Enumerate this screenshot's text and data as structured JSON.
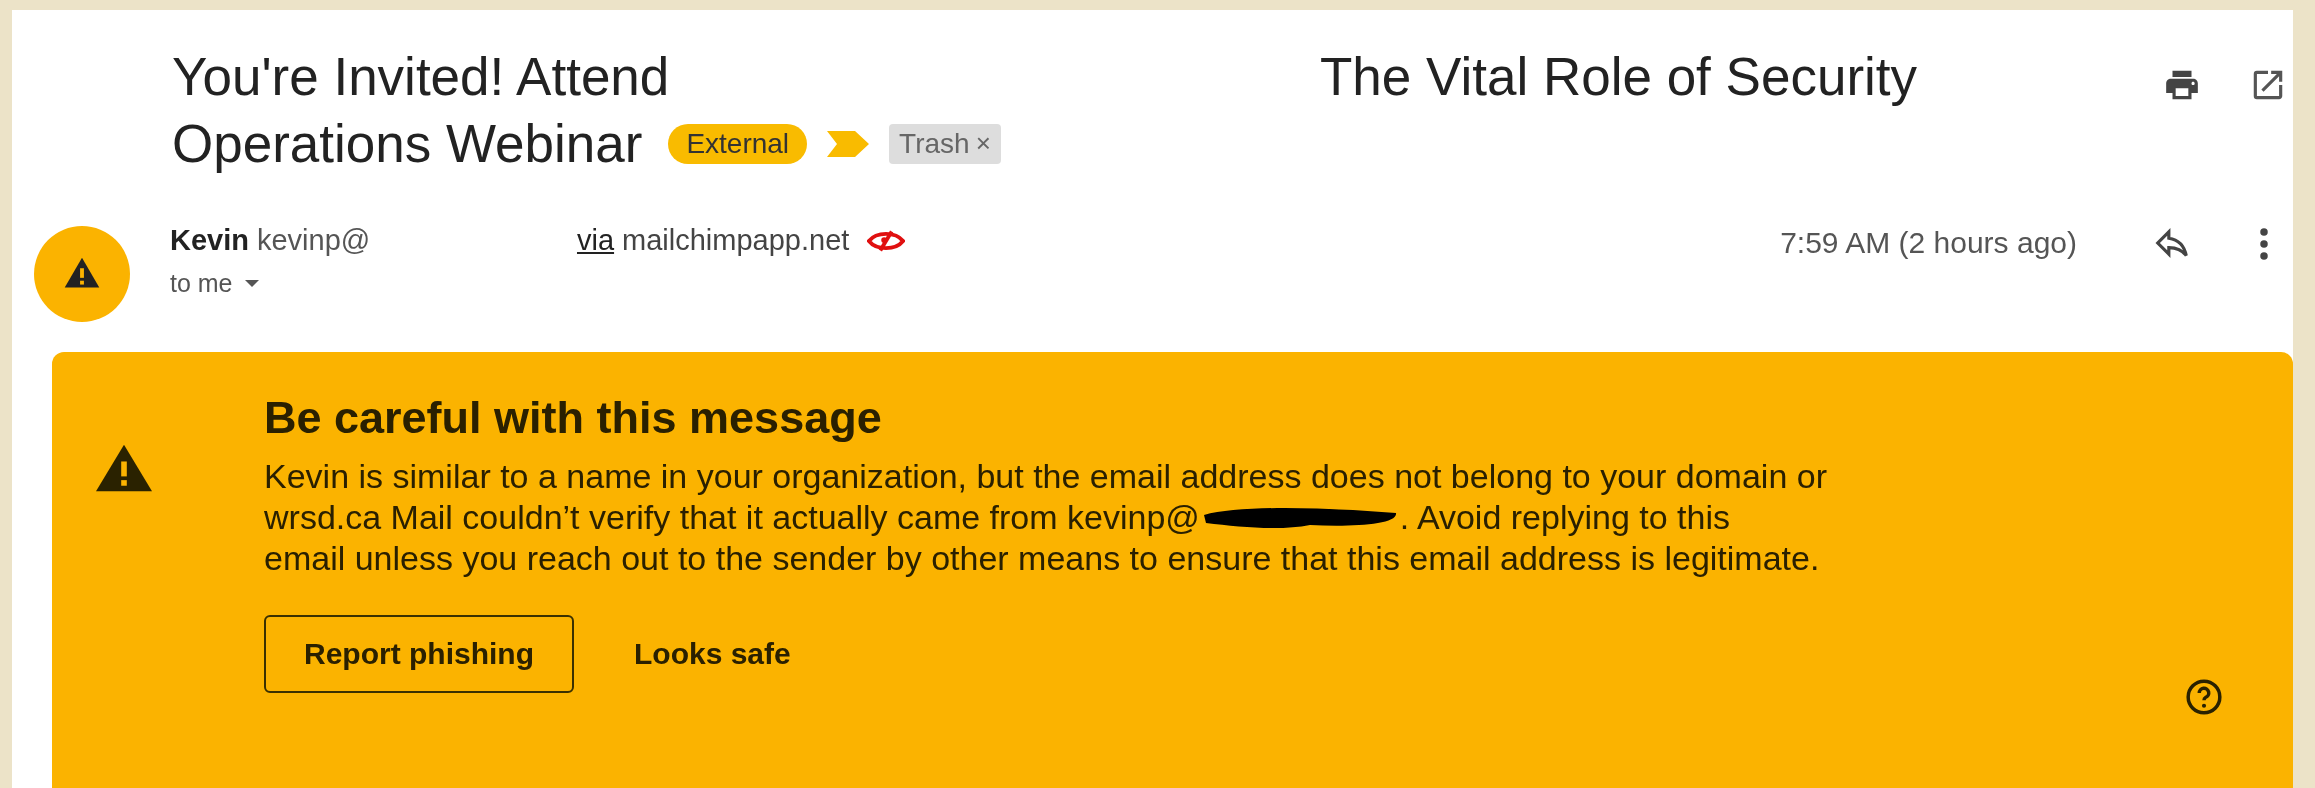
{
  "subject": {
    "line_1_start": "You're Invited! Attend",
    "line_1_end": "The Vital Role of Security",
    "line_2": "Operations Webinar"
  },
  "labels": [
    {
      "text": "External",
      "kind": "external"
    },
    {
      "text": "Trash",
      "kind": "folder",
      "remove": "×"
    }
  ],
  "sender": {
    "name": "Kevin",
    "email": "kevinp@",
    "via_prefix": "via",
    "via_domain": "mailchimpapp.net",
    "recipient": "to me"
  },
  "time": "7:59 AM (2 hours ago)",
  "warning": {
    "title": "Be careful with this message",
    "text_line_1": "Kevin is similar to a name in your organization, but the email address does not belong to your domain or",
    "text_line_2_before": "wrsd.ca Mail couldn’t verify that it actually came from kevinp@",
    "text_line_2_after": ". Avoid replying to this",
    "text_line_3": "email unless you reach out to the sender by other means to ensure that this email address is legitimate.",
    "buttons": [
      {
        "label": "Report phishing",
        "kind": "outlined"
      },
      {
        "label": "Looks safe",
        "kind": "text"
      }
    ]
  }
}
